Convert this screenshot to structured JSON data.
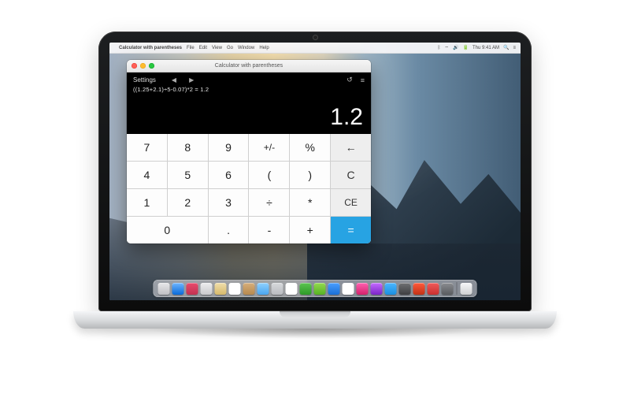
{
  "menubar": {
    "apple": "",
    "app_name": "Calculator with parentheses",
    "menus": [
      "File",
      "Edit",
      "View",
      "Go",
      "Window",
      "Help"
    ],
    "right": {
      "bt": "ᛒ",
      "wifi": "⌔",
      "vol": "🔊",
      "batt": "🔋",
      "time": "Thu 9:41 AM",
      "search": "🔍",
      "menu": "≡"
    }
  },
  "window": {
    "title": "Calculator with parentheses"
  },
  "display": {
    "settings_label": "Settings",
    "prev": "◀",
    "next": "▶",
    "undo": "↺",
    "list": "≡",
    "expression": "((1.25+2.1)÷5-0.07)*2 = 1.2",
    "result": "1.2"
  },
  "keys": {
    "r1": [
      "7",
      "8",
      "9",
      "+/-",
      "%",
      "←"
    ],
    "r2": [
      "4",
      "5",
      "6",
      "(",
      ")",
      "C"
    ],
    "r3": [
      "1",
      "2",
      "3",
      "÷",
      "*",
      "CE"
    ],
    "r4": [
      "0",
      ".",
      "-",
      "+",
      "="
    ]
  },
  "dock_colors": [
    "linear-gradient(#e7e7e9,#bfbfc3)",
    "linear-gradient(#6fb6ff,#0a6bd8)",
    "linear-gradient(#e84b6c,#c23252)",
    "linear-gradient(#ededef,#c9c9cc)",
    "linear-gradient(#f0deab,#d6b96b)",
    "#ffffff",
    "linear-gradient(#d6ae7a,#b7894e)",
    "linear-gradient(#8fd0ff,#4aa6ef)",
    "linear-gradient(#d7d9dc,#b9bbbf)",
    "#ffffff",
    "linear-gradient(#5ac451,#2e9a28)",
    "linear-gradient(#93d94e,#57b224)",
    "linear-gradient(#4a9eff,#1a6fd6)",
    "#ffffff",
    "linear-gradient(#ff5fb1,#d4236b)",
    "linear-gradient(#c46bff,#7a25c6)",
    "linear-gradient(#4bb6ff,#1a8fe0)",
    "linear-gradient(#6f7073,#3e3f42)",
    "linear-gradient(#ff5a3c,#c23216)",
    "linear-gradient(#f05a5a,#c93030)",
    "linear-gradient(#8a8c90,#5a5c60)"
  ],
  "trash_color": "linear-gradient(#f7f7f8,#cfd0d2)"
}
